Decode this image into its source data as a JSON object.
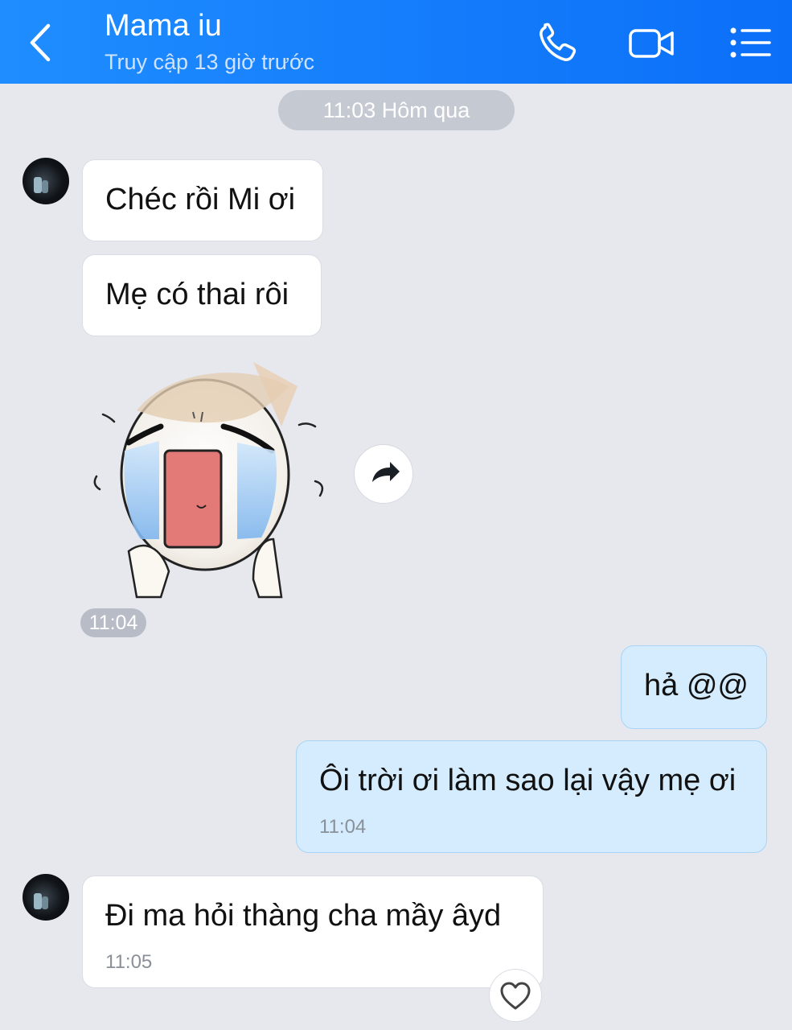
{
  "header": {
    "contact_name": "Mama iu",
    "status": "Truy cập 13 giờ trước",
    "icons": [
      "back-arrow-icon",
      "phone-icon",
      "video-call-icon",
      "menu-list-icon"
    ]
  },
  "date_separator": "11:03 Hôm qua",
  "messages": [
    {
      "side": "incoming",
      "text": "Chéc rồi Mi ơi"
    },
    {
      "side": "incoming",
      "text": "Mẹ có thai rôi"
    },
    {
      "side": "incoming",
      "type": "sticker",
      "sticker": "crying-face-sticker",
      "time": "11:04"
    },
    {
      "side": "outgoing",
      "text": "hả @@"
    },
    {
      "side": "outgoing",
      "text": "Ôi trời ơi làm sao lại vậy mẹ ơi",
      "time": "11:04"
    },
    {
      "side": "incoming",
      "text": "Đi ma hỏi thàng cha mầy âyd",
      "time": "11:05"
    }
  ],
  "colors": {
    "header": "#1f8dff",
    "background": "#e6e8ee",
    "incoming_bubble": "#ffffff",
    "outgoing_bubble": "#d4ecfe"
  }
}
